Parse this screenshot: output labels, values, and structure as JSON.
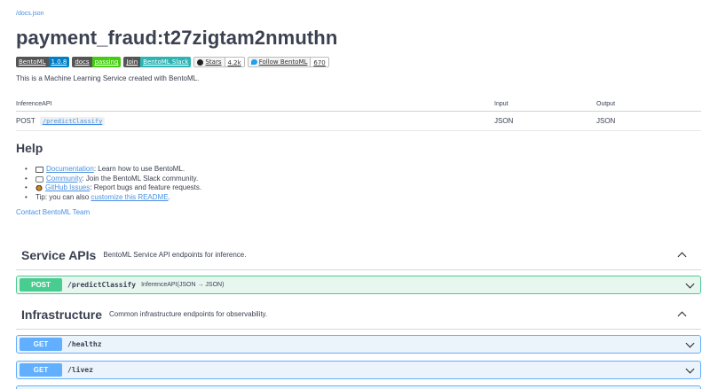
{
  "header": {
    "docs_link": "/docs.json",
    "title": "payment_fraud:t27zigtam2nmuthn",
    "description": "This is a Machine Learning Service created with BentoML."
  },
  "badges": [
    {
      "left": "BentoML",
      "right": "1.0.8",
      "color": "#007ec6"
    },
    {
      "left": "docs",
      "right": "passing",
      "color": "#44cc11"
    },
    {
      "left": "Join",
      "right": "BentoML Slack",
      "color": "#2eb3b3"
    },
    {
      "left": "Stars",
      "right": "4.2k",
      "icon": "github-icon"
    },
    {
      "left": "Follow BentoML",
      "right": "670",
      "icon": "twitter-icon"
    }
  ],
  "api_table": {
    "headers": [
      "InferenceAPI",
      "Input",
      "Output"
    ],
    "rows": [
      {
        "method": "POST",
        "path": "/predictClassify",
        "input": "JSON",
        "output": "JSON"
      }
    ]
  },
  "help": {
    "title": "Help",
    "items": [
      {
        "icon": "book-icon",
        "link": "Documentation",
        "text": ": Learn how to use BentoML."
      },
      {
        "icon": "chat-bubble-icon",
        "link": "Community",
        "text": ": Join the BentoML Slack community."
      },
      {
        "icon": "bug-icon",
        "link": "GitHub Issues",
        "text": ": Report bugs and feature requests."
      },
      {
        "prefix": "Tip: you can also ",
        "link": "customize this README",
        "text": "."
      }
    ],
    "contact": "Contact BentoML Team"
  },
  "sections": {
    "service_apis": {
      "name": "Service APIs",
      "description": "BentoML Service API endpoints for inference.",
      "operations": [
        {
          "method": "POST",
          "path": "/predictClassify",
          "summary": "InferenceAPI(JSON → JSON)"
        }
      ]
    },
    "infrastructure": {
      "name": "Infrastructure",
      "description": "Common infrastructure endpoints for observability.",
      "operations": [
        {
          "method": "GET",
          "path": "/healthz"
        },
        {
          "method": "GET",
          "path": "/livez"
        }
      ]
    }
  },
  "colors": {
    "post": "#49cc90",
    "get": "#61affe",
    "link": "#4990e2",
    "text": "#3b4151"
  }
}
